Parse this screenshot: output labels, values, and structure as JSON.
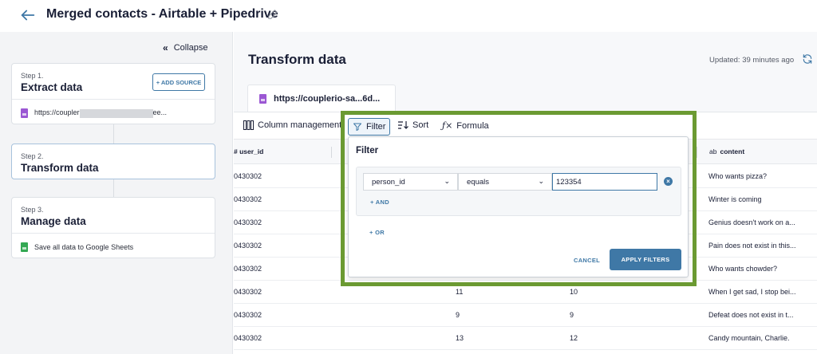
{
  "header": {
    "title": "Merged contacts - Airtable + Pipedrive",
    "back_icon": "arrow-left-icon",
    "edit_icon": "pencil-icon"
  },
  "sidebar": {
    "collapse_label": "Collapse",
    "steps": [
      {
        "number": "Step 1.",
        "title": "Extract data",
        "button": "+ ADD SOURCE",
        "source_prefix": "https://coupler",
        "source_suffix": "ee..."
      },
      {
        "number": "Step 2.",
        "title": "Transform data"
      },
      {
        "number": "Step 3.",
        "title": "Manage data",
        "destination": "Save all data to Google Sheets"
      }
    ]
  },
  "main": {
    "title": "Transform data",
    "updated": "Updated: 39 minutes ago",
    "source_tab": "https://couplerio-sa...6d...",
    "toolbar": {
      "column_management": "Column management",
      "filter": "Filter",
      "sort": "Sort",
      "formula": "Formula"
    },
    "grid": {
      "columns": [
        "# user_id",
        "content"
      ],
      "content_prefix": "ab",
      "rows": [
        {
          "user_id": "0430302",
          "col2": "",
          "col3": "",
          "content": "Who wants pizza?"
        },
        {
          "user_id": "0430302",
          "col2": "",
          "col3": "",
          "content": "Winter is coming"
        },
        {
          "user_id": "0430302",
          "col2": "",
          "col3": "",
          "content": "Genius doesn't work on a..."
        },
        {
          "user_id": "0430302",
          "col2": "",
          "col3": "",
          "content": "Pain does not exist in this..."
        },
        {
          "user_id": "0430302",
          "col2": "",
          "col3": "",
          "content": "Who wants chowder?"
        },
        {
          "user_id": "0430302",
          "col2": "11",
          "col3": "10",
          "content": "When I get sad, I stop bei..."
        },
        {
          "user_id": "0430302",
          "col2": "9",
          "col3": "9",
          "content": "Defeat does not exist in t..."
        },
        {
          "user_id": "0430302",
          "col2": "13",
          "col3": "12",
          "content": "Candy mountain, Charlie."
        }
      ]
    }
  },
  "filter_popup": {
    "title": "Filter",
    "field": "person_id",
    "operator": "equals",
    "value": "123354",
    "and_label": "+ AND",
    "or_label": "+ OR",
    "cancel_label": "CANCEL",
    "apply_label": "APPLY FILTERS"
  },
  "colors": {
    "accent": "#3f78a6",
    "highlight": "#6b9a32"
  }
}
